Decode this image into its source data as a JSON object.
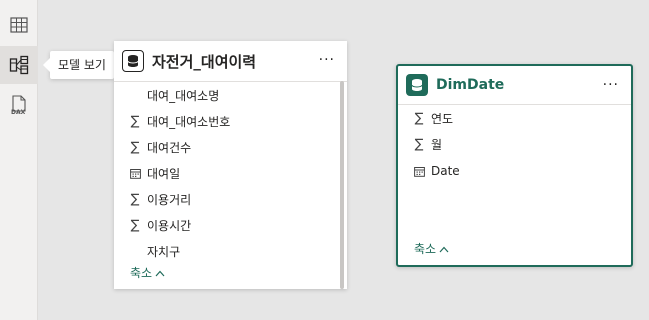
{
  "rail": {
    "items": [
      {
        "name": "table-view",
        "icon": "table-icon"
      },
      {
        "name": "model-view",
        "icon": "model-icon",
        "active": true
      },
      {
        "name": "dax-query-view",
        "icon": "dax-icon"
      }
    ],
    "tooltip": "모델 보기"
  },
  "tables": [
    {
      "title": "자전거_대여이력",
      "fields": [
        {
          "label": "대여_대여소명",
          "type": "text"
        },
        {
          "label": "대여_대여소번호",
          "type": "sum"
        },
        {
          "label": "대여건수",
          "type": "sum"
        },
        {
          "label": "대여일",
          "type": "date"
        },
        {
          "label": "이용거리",
          "type": "sum"
        },
        {
          "label": "이용시간",
          "type": "sum"
        },
        {
          "label": "자치구",
          "type": "text"
        }
      ],
      "collapse_label": "축소"
    },
    {
      "title": "DimDate",
      "fields": [
        {
          "label": "연도",
          "type": "sum"
        },
        {
          "label": "월",
          "type": "sum"
        },
        {
          "label": "Date",
          "type": "date"
        }
      ],
      "collapse_label": "축소"
    }
  ],
  "more_label": "···",
  "colors": {
    "accent": "#1f6b5a",
    "rail": "#f2f1f0",
    "canvas": "#e6e6e6"
  }
}
